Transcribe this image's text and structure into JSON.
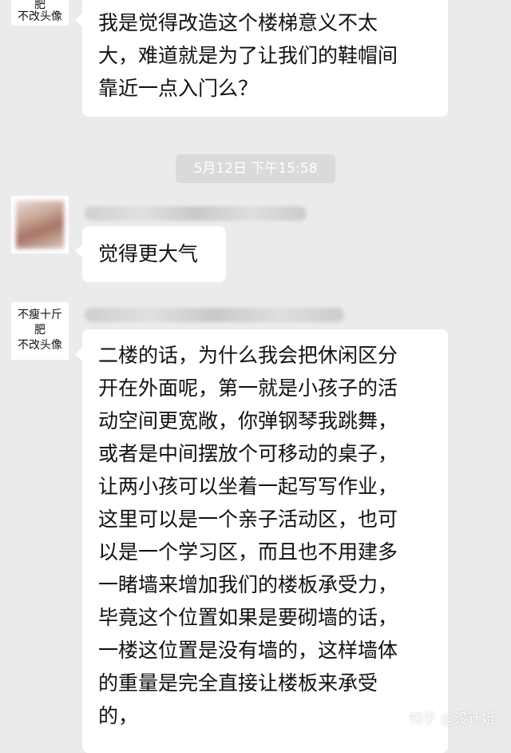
{
  "messages": [
    {
      "avatar_text": [
        "肥",
        "不改头像"
      ],
      "lines": [
        "我是觉得改造这个楼梯意义不太",
        "大，难道就是为了让我们的鞋帽间",
        "靠近一点入门么？"
      ]
    },
    {
      "lines": [
        "觉得更大气"
      ]
    },
    {
      "avatar_text": [
        "不瘦十斤",
        "肥",
        "不改头像"
      ],
      "lines": [
        "二楼的话，为什么我会把休闲区分",
        "开在外面呢，第一就是小孩子的活",
        "动空间更宽敞，你弹钢琴我跳舞，",
        "或者是中间摆放个可移动的桌子，",
        "让两小孩可以坐着一起写写作业，",
        "这里可以是一个亲子活动区，也可",
        "以是一个学习区，而且也不用建多",
        "一睹墙来增加我们的楼板承受力，",
        "毕竟这个位置如果是要砌墙的话，",
        "一楼这位置是没有墙的，这样墙体",
        "的重量是完全直接让楼板来承受",
        "的，"
      ]
    }
  ],
  "timestamp": "5月12日 下午15:58",
  "watermark": "知乎 @设计姐"
}
